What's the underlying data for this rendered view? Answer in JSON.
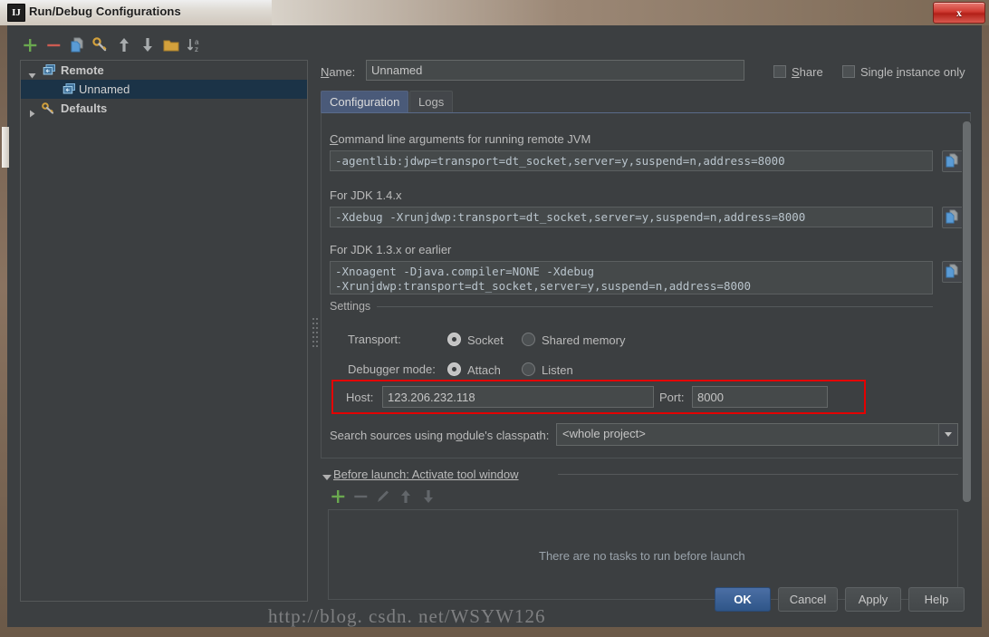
{
  "window": {
    "title": "Run/Debug Configurations",
    "app_icon": "IJ",
    "close_label": "x"
  },
  "tree_toolbar": {
    "items": [
      {
        "name": "add-icon",
        "glyph": "plus",
        "color": "#6aa84f"
      },
      {
        "name": "remove-icon",
        "glyph": "minus",
        "color": "#cc5c52"
      },
      {
        "name": "copy-configuration-icon",
        "glyph": "copy",
        "color": "#5a9bd5"
      },
      {
        "name": "save-configuration-icon",
        "glyph": "wrench",
        "color": "#d3a13c"
      },
      {
        "name": "move-up-icon",
        "glyph": "arrow-up",
        "color": "#a8acae"
      },
      {
        "name": "move-down-icon",
        "glyph": "arrow-down",
        "color": "#a8acae"
      },
      {
        "name": "new-folder-icon",
        "glyph": "folder",
        "color": "#d3a13c"
      },
      {
        "name": "sort-alphabetically-icon",
        "glyph": "sort-az",
        "color": "#a8acae"
      }
    ]
  },
  "tree": {
    "rows": [
      {
        "label": "Remote",
        "indent": 22,
        "bold": true,
        "expanded": true,
        "selected": false,
        "icon": "remote-icon",
        "has_triangle": true
      },
      {
        "label": "Unnamed",
        "indent": 44,
        "bold": false,
        "expanded": false,
        "selected": true,
        "icon": "remote-icon",
        "has_triangle": false
      },
      {
        "label": "Defaults",
        "indent": 22,
        "bold": true,
        "expanded": false,
        "selected": false,
        "icon": "wrench-icon",
        "has_triangle": true
      }
    ]
  },
  "header": {
    "name_label_pre": "N",
    "name_label_post": "ame:",
    "name_value": "Unnamed",
    "name_placeholder": "",
    "share_label_pre": "S",
    "share_label_post": "hare",
    "share_checked": false,
    "single_instance_label_pre_1": "Single ",
    "single_instance_label_u": "i",
    "single_instance_label_post": "nstance only",
    "single_instance_checked": false
  },
  "tabs": [
    {
      "label": "Configuration",
      "active": true
    },
    {
      "label": "Logs",
      "active": false
    }
  ],
  "configuration": {
    "cmdline": {
      "label_u": "C",
      "label_rest": "ommand line arguments for running remote JVM",
      "value": "-agentlib:jdwp=transport=dt_socket,server=y,suspend=n,address=8000",
      "copy_icon": "copy-icon"
    },
    "jdk14": {
      "label": "For JDK 1.4.x",
      "value": "-Xdebug -Xrunjdwp:transport=dt_socket,server=y,suspend=n,address=8000",
      "copy_icon": "copy-icon"
    },
    "jdk13": {
      "label": "For JDK 1.3.x or earlier",
      "value": "-Xnoagent -Djava.compiler=NONE -Xdebug\n-Xrunjdwp:transport=dt_socket,server=y,suspend=n,address=8000",
      "copy_icon": "copy-icon"
    },
    "settings": {
      "group_title": "Settings",
      "transport_label": "Transport:",
      "transport_options": [
        {
          "label": "Socket",
          "selected": true
        },
        {
          "label": "Shared memory",
          "selected": false
        }
      ],
      "debugger_mode_label": "Debugger mode:",
      "debugger_mode_options": [
        {
          "label": "Attach",
          "selected": true
        },
        {
          "label": "Listen",
          "selected": false
        }
      ],
      "host_label": "Host:",
      "host_value": "123.206.232.118",
      "port_label": "Port:",
      "port_value": "8000",
      "highlight_color": "#e40000"
    },
    "classpath": {
      "label_pre": "Search sources using m",
      "label_u": "o",
      "label_post": "dule's classpath:",
      "value": "<whole project>"
    }
  },
  "before_launch": {
    "header_pre": "B",
    "header_post": "efore launch: Activate tool window",
    "toolbar": [
      {
        "name": "add-task-icon",
        "glyph": "plus",
        "enabled": true
      },
      {
        "name": "remove-task-icon",
        "glyph": "minus",
        "enabled": false
      },
      {
        "name": "edit-task-icon",
        "glyph": "pencil",
        "enabled": false
      },
      {
        "name": "move-task-up-icon",
        "glyph": "arrow-up",
        "enabled": false
      },
      {
        "name": "move-task-down-icon",
        "glyph": "arrow-down",
        "enabled": false
      }
    ],
    "empty_text": "There are no tasks to run before launch"
  },
  "footer": {
    "buttons": [
      {
        "label": "OK",
        "default": true
      },
      {
        "label": "Cancel",
        "default": false
      },
      {
        "label": "Apply",
        "default": false
      },
      {
        "label": "Help",
        "default": false
      }
    ]
  },
  "watermark": {
    "text": "http://blog. csdn. net/WSYW126"
  }
}
